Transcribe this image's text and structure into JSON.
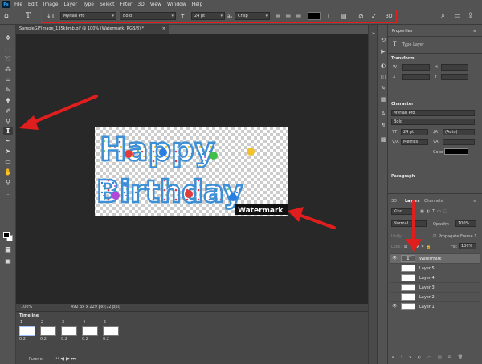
{
  "menu": [
    "File",
    "Edit",
    "Image",
    "Layer",
    "Type",
    "Select",
    "Filter",
    "3D",
    "View",
    "Window",
    "Help"
  ],
  "options": {
    "font_family": "Myriad Pro",
    "font_style": "Bold",
    "font_size": "24 pt",
    "antialias": "Crisp",
    "color": "#000000"
  },
  "document": {
    "tab_title": "SampleGIFImage_135kbmb.gif @ 100% (Watermark, RGB/8) *",
    "canvas_text_line1": "Happy",
    "canvas_text_line2": "Birthday",
    "watermark": "Watermark",
    "zoom": "100%",
    "status": "492 px x 229 px (72 ppi)"
  },
  "timeline": {
    "title": "Timeline",
    "frames": [
      {
        "num": "1",
        "dur": "0.2"
      },
      {
        "num": "2",
        "dur": "0.2"
      },
      {
        "num": "3",
        "dur": "0.2"
      },
      {
        "num": "4",
        "dur": "0.2"
      },
      {
        "num": "5",
        "dur": "0.2"
      }
    ],
    "loop": "Forever"
  },
  "properties": {
    "tab": "Properties",
    "type_layer_label": "Type Layer",
    "transform": "Transform",
    "character": "Character",
    "font_family": "Myriad Pro",
    "font_style": "Bold",
    "size": "24 pt",
    "leading": "(Auto)",
    "kerning": "Metrics",
    "color_label": "Color",
    "paragraph": "Paragraph"
  },
  "layers_panel": {
    "tabs": [
      "3D",
      "Layers",
      "Channels"
    ],
    "kind": "Kind",
    "blend_mode": "Normal",
    "opacity_label": "Opacity:",
    "opacity": "100%",
    "unify_label": "Unify:",
    "propagate_label": "Propagate Frame 1",
    "lock_label": "Lock:",
    "fill_label": "Fill:",
    "fill": "100%",
    "layers": [
      {
        "name": "Watermark",
        "visible": true,
        "selected": true
      },
      {
        "name": "Layer 5",
        "visible": false,
        "selected": false
      },
      {
        "name": "Layer 4",
        "visible": false,
        "selected": false
      },
      {
        "name": "Layer 3",
        "visible": false,
        "selected": false
      },
      {
        "name": "Layer 2",
        "visible": false,
        "selected": false
      },
      {
        "name": "Layer 1",
        "visible": true,
        "selected": false
      }
    ]
  },
  "colors": {
    "highlight": "#e01e1e",
    "panel_bg": "#535353",
    "canvas_bg": "#282828"
  }
}
